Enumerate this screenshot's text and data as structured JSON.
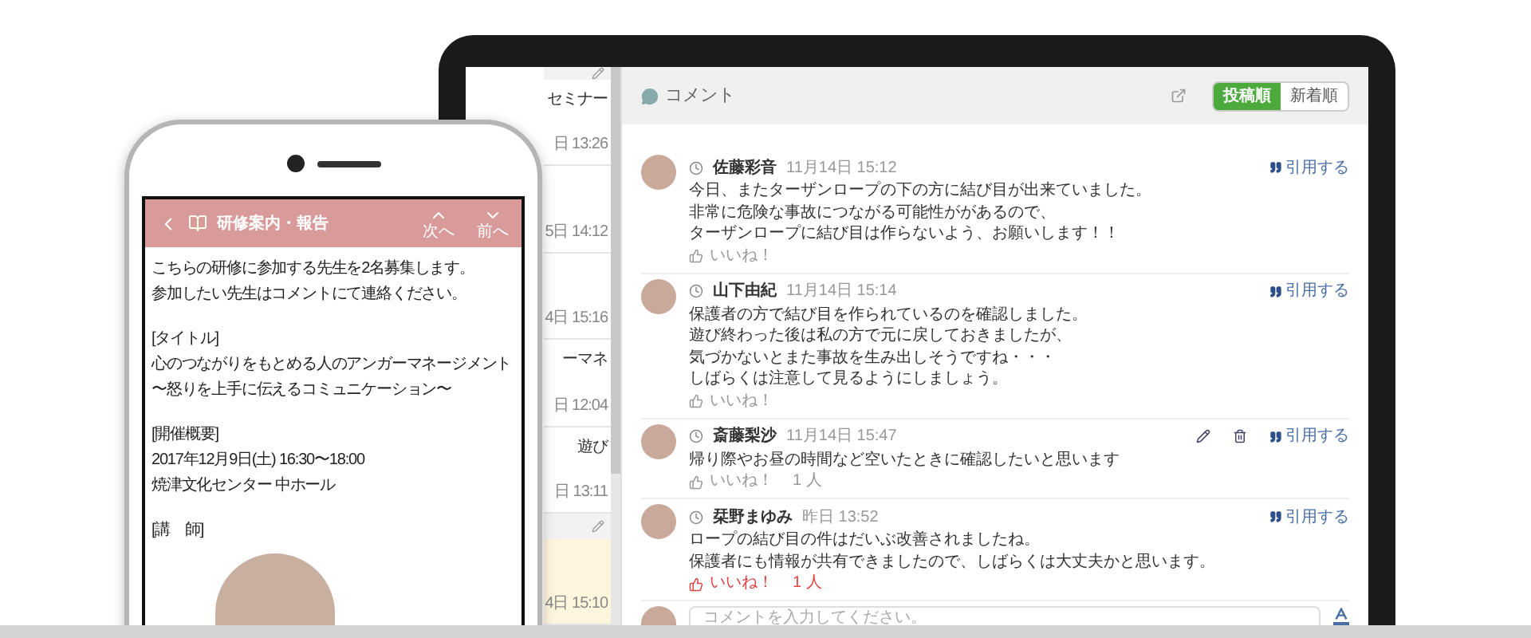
{
  "laptop": {
    "list": {
      "items": [
        {
          "title": "セミナー",
          "time": "日 13:26",
          "selected": false
        },
        {
          "time": "5日 14:12",
          "selected": false
        },
        {
          "time": "4日 15:16",
          "selected": false
        },
        {
          "title": "ーマネ",
          "time": "日 12:04",
          "selected": false
        },
        {
          "title": "遊び",
          "time": "日 13:11",
          "selected": false
        },
        {
          "time": "4日 15:10",
          "selected": true
        }
      ]
    },
    "comments": {
      "title": "コメント",
      "sort": [
        {
          "label": "投稿順",
          "selected": true
        },
        {
          "label": "新着順",
          "selected": false
        }
      ],
      "items": [
        {
          "author": "佐藤彩音",
          "time": "11月14日 15:12",
          "lines": [
            "今日、またターザンロープの下の方に結び目が出来ていました。",
            "非常に危険な事故につながる可能性ががあるので、",
            "ターザンロープに結び目は作らないよう、お願いします！！"
          ],
          "quote": "引用する",
          "like": "いいね！",
          "liked": false,
          "editable": false
        },
        {
          "author": "山下由紀",
          "time": "11月14日 15:14",
          "lines": [
            "保護者の方で結び目を作られているのを確認しました。",
            "遊び終わった後は私の方で元に戻しておきましたが、",
            "気づかないとまた事故を生み出しそうですね・・・",
            "しばらくは注意して見るようにしましょう。"
          ],
          "quote": "引用する",
          "like": "いいね！",
          "liked": false,
          "editable": false
        },
        {
          "author": "斎藤梨沙",
          "time": "11月14日 15:47",
          "lines": [
            "帰り際やお昼の時間など空いたときに確認したいと思います"
          ],
          "quote": "引用する",
          "like": "いいね！",
          "count": "1 人",
          "liked": false,
          "editable": true
        },
        {
          "author": "栞野まゆみ",
          "time": "昨日 13:52",
          "lines": [
            "ロープの結び目の件はだいぶ改善されましたね。",
            "保護者にも情報が共有できましたので、しばらくは大丈夫かと思います。"
          ],
          "quote": "引用する",
          "like": "いいね！",
          "count": "1 人",
          "liked": true,
          "editable": false
        }
      ],
      "input": {
        "placeholder": "コメントを入力してください。"
      }
    }
  },
  "phone": {
    "header": {
      "title": "研修案内・報告",
      "up": "次へ",
      "down": "前へ"
    },
    "blocks": [
      [
        "こちらの研修に参加する先生を2名募集します。",
        "参加したい先生はコメントにて連絡ください。"
      ],
      [
        "[タイトル]",
        "心のつながりをもとめる人のアンガーマネージメント",
        "〜怒りを上手に伝えるコミュニケーション〜"
      ],
      [
        "[開催概要]",
        "2017年12月9日(土)  16:30〜18:00",
        "焼津文化センター 中ホール"
      ],
      [
        "[講　師]"
      ]
    ]
  }
}
